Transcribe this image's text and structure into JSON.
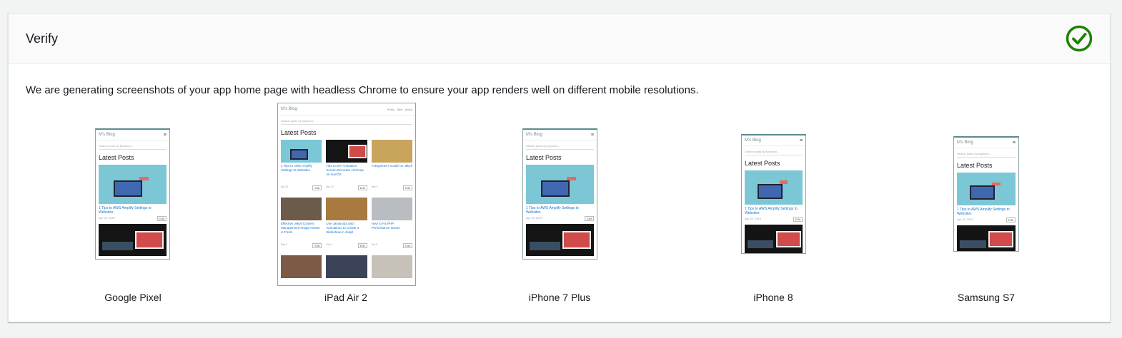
{
  "panel": {
    "title": "Verify",
    "description": "We are generating screenshots of your app home page with headless Chrome to ensure your app renders well on different mobile resolutions.",
    "status_icon": "check-circle-icon",
    "status_color": "#1d8102"
  },
  "mini_site": {
    "brand": "M's Blog",
    "search_placeholder": "Search posts by keyword...",
    "heading": "Latest Posts",
    "post1_title": "1 Tips to AWS Amplify Settings to Websites",
    "edit_label": "Edit"
  },
  "devices": [
    {
      "label": "Google Pixel"
    },
    {
      "label": "iPad Air 2"
    },
    {
      "label": "iPhone 7 Plus"
    },
    {
      "label": "iPhone 8"
    },
    {
      "label": "Samsung S7"
    }
  ]
}
